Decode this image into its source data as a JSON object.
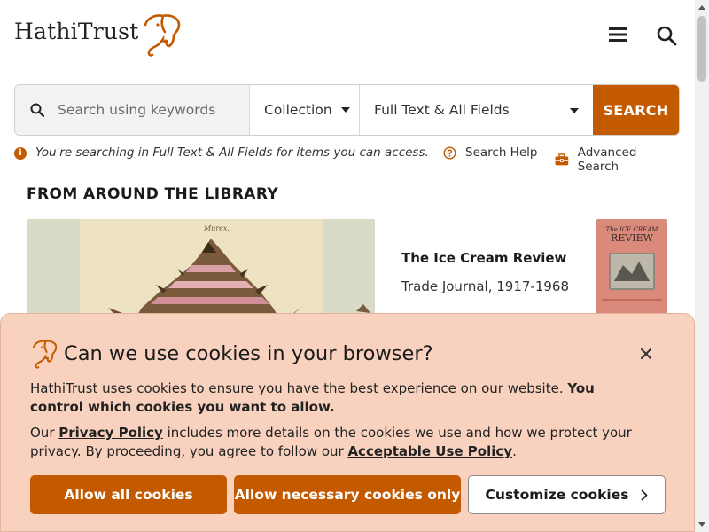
{
  "header": {
    "logo_text": "HathiTrust",
    "icons": [
      "menu-icon",
      "search-icon"
    ]
  },
  "search": {
    "placeholder": "Search using keywords",
    "collection_label": "Collection",
    "field_label": "Full Text & All Fields",
    "button_label": "SEARCH",
    "info_text": "You're searching in Full Text & All Fields for items you can access.",
    "help_label": "Search Help",
    "advanced_label": "Advanced Search"
  },
  "library": {
    "section_title": "FROM AROUND THE LIBRARY",
    "feature_caption": "Murex.",
    "item_title": "The Ice Cream Review",
    "item_subtitle": "Trade Journal, 1917-1968",
    "thumb_line1": "The ICE CREAM",
    "thumb_line2": "REVIEW"
  },
  "cookie": {
    "title": "Can we use cookies in your browser?",
    "p1_text": "HathiTrust uses cookies to ensure you have the best experience on our website. ",
    "p1_bold": "You control which cookies you want to allow.",
    "p2_a": "Our ",
    "privacy_link": "Privacy Policy",
    "p2_b": " includes more details on the cookies we use and how we protect your privacy. By proceeding, you agree to follow our ",
    "aup_link": "Acceptable Use Policy",
    "p2_c": ".",
    "allow_all_label": "Allow all cookies",
    "necessary_label": "Allow necessary cookies only",
    "customize_label": "Customize cookies"
  },
  "colors": {
    "accent": "#c35a00",
    "cookie_bg": "#f8d2be"
  }
}
